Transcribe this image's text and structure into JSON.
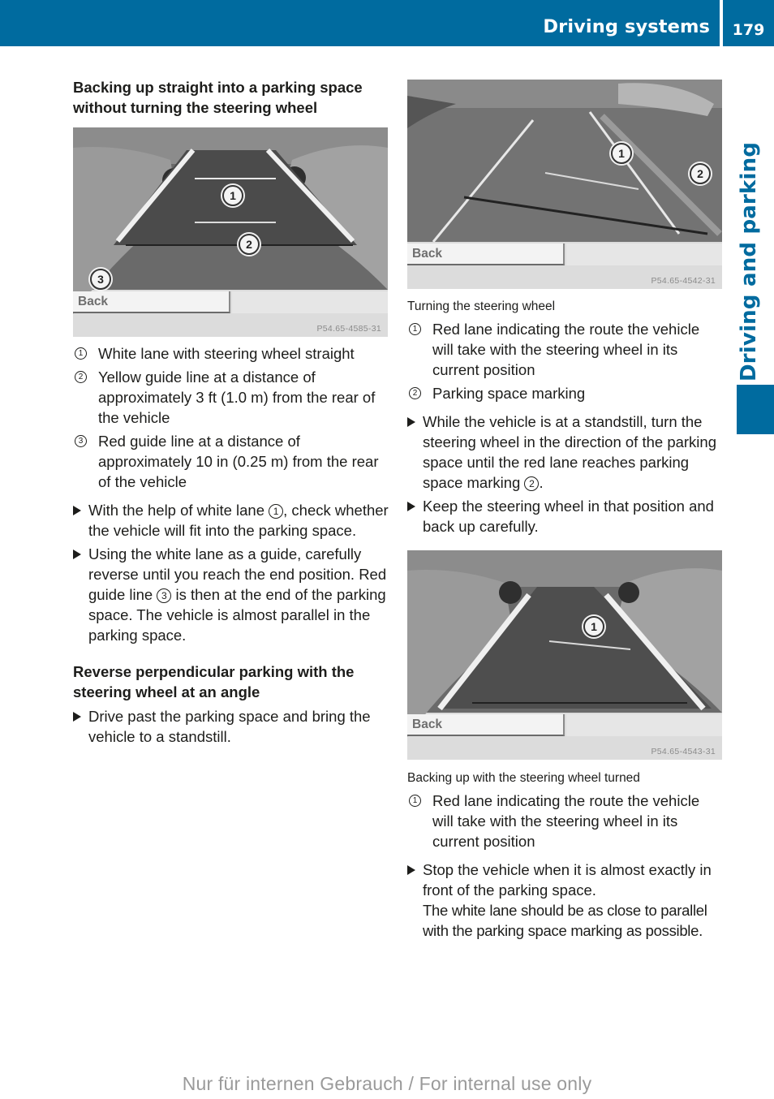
{
  "header": {
    "section_title": "Driving systems",
    "page_number": "179",
    "side_tab_label": "Driving and parking",
    "accent_color": "#006b9f"
  },
  "left_column": {
    "heading1": "Backing up straight into a parking space without turning the steering wheel",
    "figure1": {
      "back_label": "Back",
      "code": "P54.65-4585-31",
      "callouts": [
        "1",
        "2",
        "3"
      ]
    },
    "legend": [
      {
        "num": "1",
        "text": "White lane with steering wheel straight"
      },
      {
        "num": "2",
        "text": "Yellow guide line at a distance of approximately 3 ft (1.0 m) from the rear of the vehicle"
      },
      {
        "num": "3",
        "text": "Red guide line at a distance of approximately 10 in (0.25 m) from the rear of the vehicle"
      }
    ],
    "steps": [
      {
        "before": "With the help of white lane ",
        "ref": "1",
        "after": ", check whether the vehicle will fit into the parking space."
      },
      {
        "before": "Using the white lane as a guide, carefully reverse until you reach the end position. Red guide line ",
        "ref": "3",
        "after": " is then at the end of the parking space. The vehicle is almost parallel in the parking space."
      }
    ],
    "heading2": "Reverse perpendicular parking with the steering wheel at an angle",
    "steps2": [
      {
        "text": "Drive past the parking space and bring the vehicle to a standstill."
      }
    ]
  },
  "right_column": {
    "figure2": {
      "back_label": "Back",
      "code": "P54.65-4542-31",
      "callouts": [
        "1",
        "2"
      ],
      "caption": "Turning the steering wheel"
    },
    "legend2": [
      {
        "num": "1",
        "text": "Red lane indicating the route the vehicle will take with the steering wheel in its current position"
      },
      {
        "num": "2",
        "text": "Parking space marking"
      }
    ],
    "steps": [
      {
        "before": "While the vehicle is at a standstill, turn the steering wheel in the direction of the parking space until the red lane reaches parking space marking ",
        "ref": "2",
        "after": "."
      },
      {
        "before": "Keep the steering wheel in that position and back up carefully.",
        "ref": "",
        "after": ""
      }
    ],
    "figure3": {
      "back_label": "Back",
      "code": "P54.65-4543-31",
      "callouts": [
        "1"
      ],
      "caption": "Backing up with the steering wheel turned"
    },
    "legend3": [
      {
        "num": "1",
        "text": "Red lane indicating the route the vehicle will take with the steering wheel in its current position"
      }
    ],
    "steps3": [
      {
        "text": "Stop the vehicle when it is almost exactly in front of the parking space.",
        "note": "The white lane should be as close to parallel with the parking space marking as possible."
      }
    ]
  },
  "footer": {
    "watermark": "Nur für internen Gebrauch / For internal use only"
  }
}
